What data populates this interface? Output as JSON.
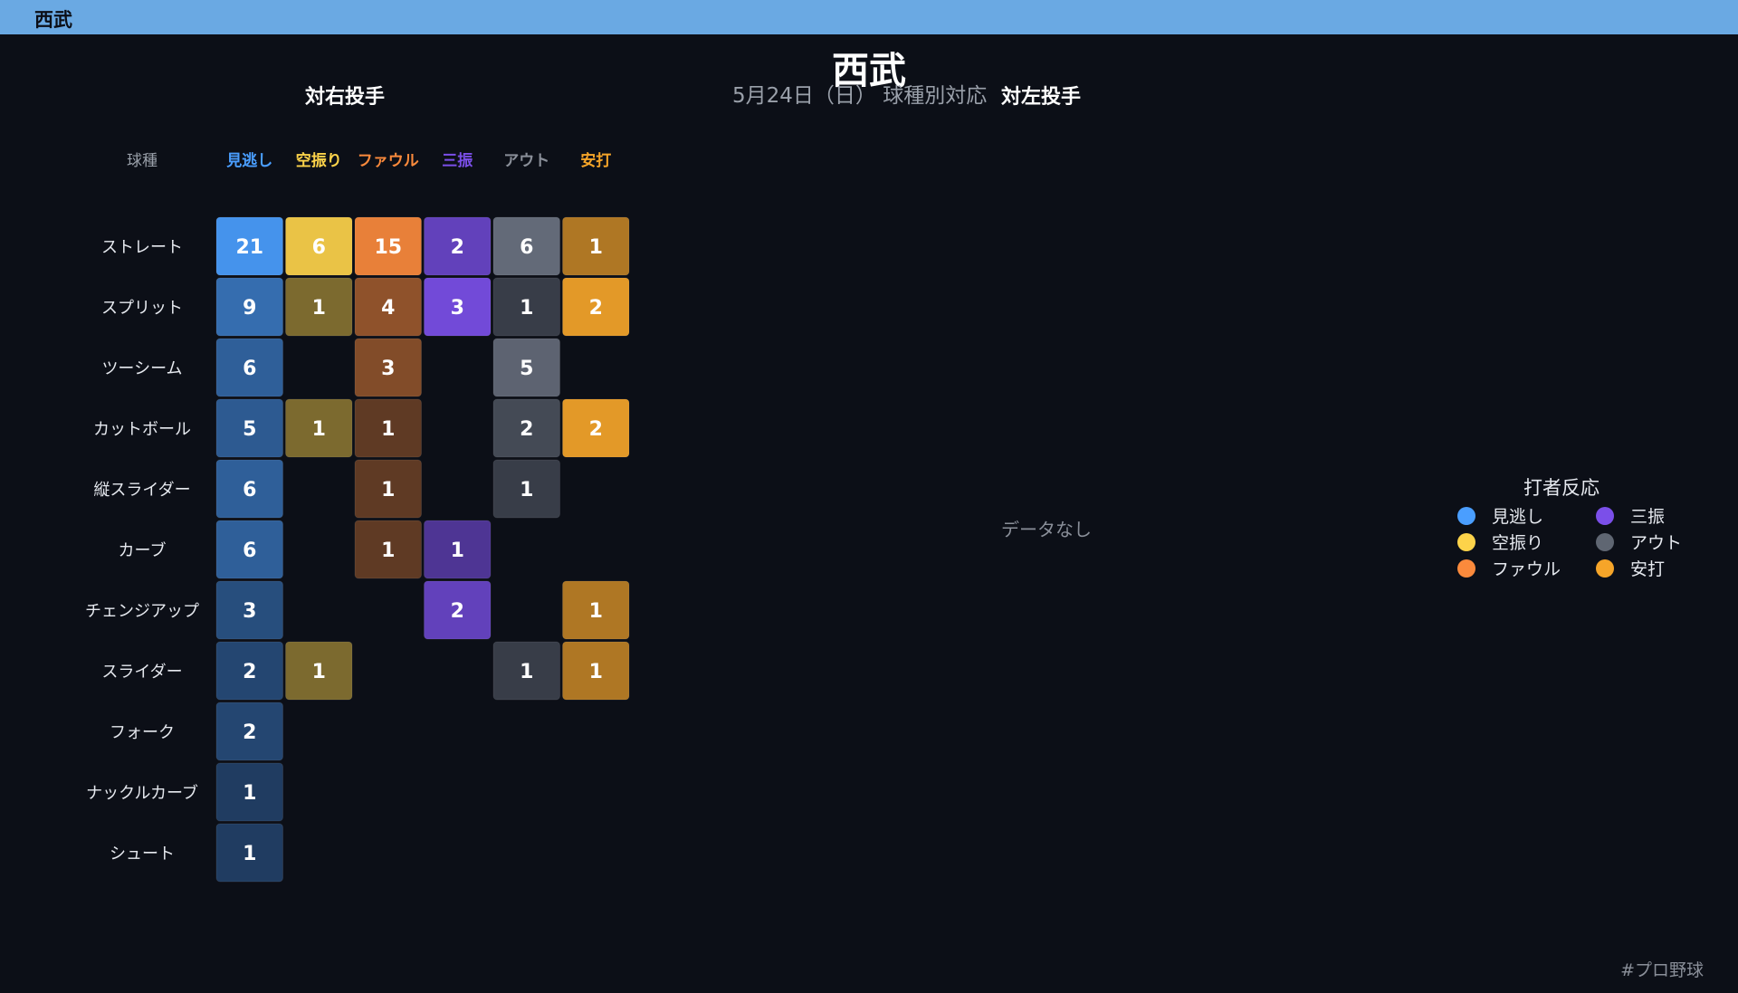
{
  "header": {
    "team": "西武"
  },
  "title": "西武",
  "subtitle": "5月24日（日） 球種別対応",
  "panels": {
    "right": "対右投手",
    "left": "対左投手"
  },
  "no_data": "データなし",
  "footer": {
    "hashtag": "#プロ野球"
  },
  "legend": {
    "title": "打者反応",
    "items": [
      {
        "label": "見逃し",
        "color": "#4a9eff"
      },
      {
        "label": "三振",
        "color": "#7b4fe9"
      },
      {
        "label": "空振り",
        "color": "#fdd34a"
      },
      {
        "label": "アウト",
        "color": "#5f6672"
      },
      {
        "label": "ファウル",
        "color": "#fb8a3c"
      },
      {
        "label": "安打",
        "color": "#f6a529"
      }
    ]
  },
  "chart_data": {
    "type": "heatmap",
    "row_header": "球種",
    "columns": [
      {
        "label": "見逃し",
        "color": "#4a9eff"
      },
      {
        "label": "空振り",
        "color": "#fdd34a"
      },
      {
        "label": "ファウル",
        "color": "#fb8a3c"
      },
      {
        "label": "三振",
        "color": "#7b4fe9"
      },
      {
        "label": "アウト",
        "color": "#6b7280"
      },
      {
        "label": "安打",
        "color": "#f6a529"
      }
    ],
    "rows": [
      "ストレート",
      "スプリット",
      "ツーシーム",
      "カットボール",
      "縦スライダー",
      "カーブ",
      "チェンジアップ",
      "スライダー",
      "フォーク",
      "ナックルカーブ",
      "シュート"
    ],
    "values": [
      [
        21,
        6,
        15,
        2,
        6,
        1
      ],
      [
        9,
        1,
        4,
        3,
        1,
        2
      ],
      [
        6,
        null,
        3,
        null,
        5,
        null
      ],
      [
        5,
        1,
        1,
        null,
        2,
        2
      ],
      [
        6,
        null,
        1,
        null,
        1,
        null
      ],
      [
        6,
        null,
        1,
        1,
        null,
        null
      ],
      [
        3,
        null,
        null,
        2,
        null,
        1
      ],
      [
        2,
        1,
        null,
        null,
        1,
        1
      ],
      [
        2,
        null,
        null,
        null,
        null,
        null
      ],
      [
        1,
        null,
        null,
        null,
        null,
        null
      ],
      [
        1,
        null,
        null,
        null,
        null,
        null
      ]
    ]
  }
}
